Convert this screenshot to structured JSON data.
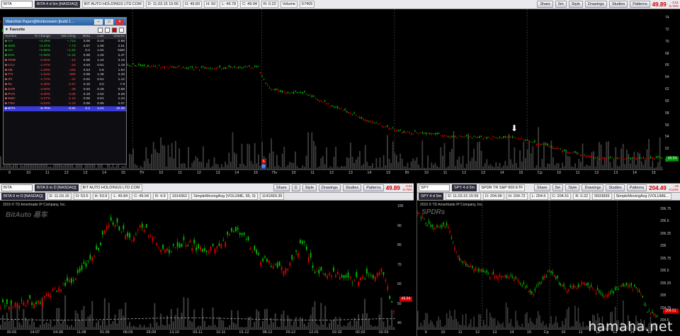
{
  "top": {
    "symbol": "BITA",
    "tag": "BITA 4 d 5m [NASDAQ]",
    "company": "BIT AUTO HOLDINGS LTD.COM",
    "d": "D: 11.03.15 15:55",
    "o": "O: 49.83",
    "h": "H: 50",
    "l": "L: 49.78",
    "c": "C: 49.94",
    "r": "R: 0.22",
    "volume_label": "Volume",
    "volume": "67405",
    "price": "49.89",
    "chg1": "-3.61",
    "chg2": "-6.75%",
    "last_tag": "49.94",
    "x_labels": [
      "9",
      "10",
      "11",
      "12",
      "13",
      "14",
      "15",
      "Пт",
      "10",
      "11",
      "12",
      "13",
      "14",
      "15",
      "Пн",
      "10",
      "11",
      "12",
      "13",
      "14",
      "15",
      "Вт",
      "10",
      "11",
      "12",
      "13",
      "14",
      "15",
      "Ср",
      "10",
      "11",
      "12",
      "13",
      "14",
      "15"
    ],
    "y_labels": [
      "74",
      "72",
      "70",
      "68",
      "66",
      "64",
      "62",
      "60",
      "58",
      "56",
      "54",
      "52",
      "50"
    ],
    "event_markers": [
      {
        "label": "S"
      },
      {
        "label": "D"
      }
    ]
  },
  "toolbar": {
    "share": "Share",
    "period": "5m",
    "style": "Style",
    "drawings": "Drawings",
    "studies": "Studies",
    "patterns": "Patterns"
  },
  "watchlist": {
    "title": "Watchlist Paper@thinkorswim [build 1...",
    "group": "Favorite",
    "columns": [
      "Symbol",
      "% Change",
      "Net Chng",
      "Beta",
      "Last",
      "Volume"
    ],
    "rows": [
      {
        "s": "GY",
        "pct": "+3.49%",
        "net": "+.715",
        "a": "0.06",
        "b": "0.43",
        "c": "0.98",
        "dir": "up"
      },
      {
        "s": "SNN",
        "pct": "+3.37%",
        "net": "+.73",
        "a": "0.07",
        "b": "1.06",
        "c": "2.51",
        "dir": "up"
      },
      {
        "s": "OA",
        "pct": "+2.55%",
        "net": "+1.84",
        "a": "0.2",
        "b": "1.81",
        "c": "NaN",
        "dir": "up"
      },
      {
        "s": "DVA",
        "pct": "+1.59%",
        "net": "+1.24",
        "a": "0.08",
        "b": "1.25",
        "c": "2.47",
        "dir": "up"
      },
      {
        "s": "TDW",
        "pct": "-0.65%",
        "net": "-.16",
        "a": "0.08",
        "b": "1.24",
        "c": "3.15",
        "dir": "dn"
      },
      {
        "s": "CCJ",
        "pct": "-1.07%",
        "net": "-.15",
        "a": "0.03",
        "b": "0.51",
        "c": "1.19",
        "dir": "dn"
      },
      {
        "s": "NE",
        "pct": "-1.09%",
        "net": "-.155",
        "a": "0.04",
        "b": "0.8",
        "c": "1.94",
        "dir": "dn"
      },
      {
        "s": "FTI",
        "pct": "-1.54%",
        "net": "-.585",
        "a": "0.08",
        "b": "1.36",
        "c": "3.33",
        "dir": "dn"
      },
      {
        "s": "IPI",
        "pct": "-1.72%",
        "net": "-.21",
        "a": "0.02",
        "b": "0.51",
        "c": "1.12",
        "dir": "dn"
      },
      {
        "s": "RL",
        "pct": "-2.28%",
        "net": "-2.97",
        "a": "0.15",
        "b": "3.0",
        "c": "7.9",
        "dir": "dn"
      },
      {
        "s": "DAR",
        "pct": "-2.60%",
        "net": "-.38",
        "a": "0.03",
        "b": "0.49",
        "c": "0.89",
        "dir": "dn"
      },
      {
        "s": "PVH",
        "pct": "-3.06%",
        "net": "-3.06",
        "a": "0.18",
        "b": "2.52",
        "c": "5.28",
        "dir": "dn"
      },
      {
        "s": "EMC",
        "pct": "-4.27%",
        "net": "-1.15",
        "a": "0.05",
        "b": "0.61",
        "c": "1.44",
        "dir": "dn"
      },
      {
        "s": "TSN",
        "pct": "-5.53%",
        "net": "-2.20",
        "a": "0.08",
        "b": "0.95",
        "c": "2.07",
        "dir": "dn"
      },
      {
        "s": "BITA",
        "pct": "-6.75%",
        "net": "-3.61",
        "a": "0.2",
        "b": "4.21",
        "c": "10.36",
        "dir": "sel"
      }
    ]
  },
  "bl": {
    "symbol": "BITA",
    "tag": "BITA 9 m D [NASDAQ]",
    "company": "BIT AUTO HOLDINGS LTD.COM",
    "period": "D",
    "d": "D: 11.03.15",
    "o": "O: 53.5",
    "h": "H: 53.9",
    "l": "L: 49.84",
    "c": "C: 49.94",
    "r": "R: 4.9",
    "volume": "1914362",
    "study": "SimpleMovingAvg (VOLUME, 65, 0)",
    "study_val": "1141669.35",
    "price": "49.89",
    "chg1": "-3.61",
    "chg2": "-6.75%",
    "copyright": "2015 © TD Ameritrade IP Company, Inc.",
    "logo": "BitAuto 易车",
    "last_tag": "49.94",
    "x_labels": [
      "30.06",
      "14.07",
      "04.08",
      "11.08",
      "01.09",
      "08.09",
      "29.09",
      "13.10",
      "03.11",
      "10.11",
      "01.12",
      "08.12",
      "29.12",
      "12.01",
      "02.02",
      "02.02",
      "02.03"
    ],
    "y_labels": [
      "100",
      "90",
      "80",
      "70",
      "60",
      "50",
      "40"
    ]
  },
  "br": {
    "symbol": "SPY",
    "tag": "SPY 4 d 5m",
    "company": "SPDR TR S&P 500 ETF",
    "period": "5m",
    "d": "D: 11.03.15 15:55",
    "o": "O: 204.99",
    "h": "H: 204.72",
    "l": "L: 204.5",
    "c": "C: 204.51",
    "r": "R: 0.22",
    "volume": "5503836",
    "study": "SimpleMovingAvg (VOLUME...",
    "price": "204.49",
    "chg1": "-.49",
    "chg2": "-0.24%",
    "copyright": "2015 © TD Ameritrade IP Company, Inc.",
    "logo": "SPDRs",
    "last_tag": "204.51",
    "x_labels": [
      "9",
      "10",
      "11",
      "12",
      "13",
      "14",
      "15",
      "Ср",
      "10",
      "11",
      "12",
      "13",
      "14",
      "15"
    ],
    "y_labels": [
      "206.75",
      "206.5",
      "206.25",
      "206",
      "205.75",
      "205.5",
      "205.25",
      "205",
      "204.75",
      "204.5"
    ]
  },
  "watermark": "hamaha.net",
  "colors": {
    "up": "#00c000",
    "down": "#e00000",
    "volume": "#3c3c3c",
    "accent": "#d00000"
  }
}
